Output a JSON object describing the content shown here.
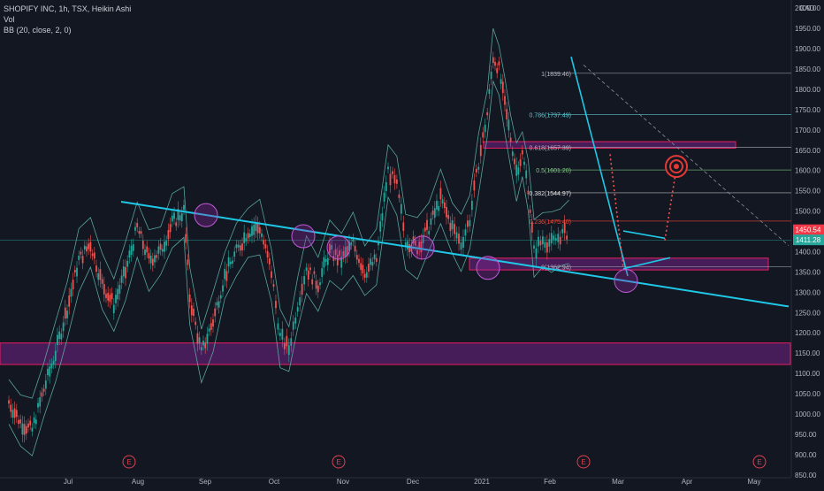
{
  "legend": {
    "title": "SHOPIFY INC, 1h, TSX, Heikin Ashi",
    "volume": "Vol",
    "bollinger": "BB (20, close, 2, 0)"
  },
  "chart_data": {
    "type": "line",
    "currency": "CAD",
    "y_ticks": [
      850,
      900,
      950,
      1000,
      1050,
      1100,
      1150,
      1200,
      1250,
      1300,
      1350,
      1400,
      1450,
      1500,
      1550,
      1600,
      1650,
      1700,
      1750,
      1800,
      1850,
      1900,
      1950,
      2000
    ],
    "y_tick_labels": [
      "850.00",
      "900.00",
      "950.00",
      "1000.00",
      "1050.00",
      "1100.00",
      "1150.00",
      "1200.00",
      "1250.00",
      "1300.00",
      "1350.00",
      "1400.00",
      "1450.00",
      "1500.00",
      "1550.00",
      "1600.00",
      "1650.00",
      "1700.00",
      "1750.00",
      "1800.00",
      "1850.00",
      "1900.00",
      "1950.00",
      "2000.00"
    ],
    "ylim": [
      843,
      2020
    ],
    "x_labels": [
      "Jul",
      "Aug",
      "Sep",
      "Oct",
      "Nov",
      "Dec",
      "2021",
      "Feb",
      "Mar",
      "Apr",
      "May"
    ],
    "price_path": [
      {
        "t": 0,
        "p": 1030
      },
      {
        "t": 4,
        "p": 980
      },
      {
        "t": 8,
        "p": 960
      },
      {
        "t": 12,
        "p": 1060
      },
      {
        "t": 16,
        "p": 1150
      },
      {
        "t": 20,
        "p": 1260
      },
      {
        "t": 24,
        "p": 1380
      },
      {
        "t": 28,
        "p": 1420
      },
      {
        "t": 32,
        "p": 1320
      },
      {
        "t": 36,
        "p": 1270
      },
      {
        "t": 40,
        "p": 1350
      },
      {
        "t": 44,
        "p": 1460
      },
      {
        "t": 48,
        "p": 1380
      },
      {
        "t": 52,
        "p": 1400
      },
      {
        "t": 56,
        "p": 1470
      },
      {
        "t": 60,
        "p": 1500
      },
      {
        "t": 62,
        "p": 1290
      },
      {
        "t": 66,
        "p": 1150
      },
      {
        "t": 70,
        "p": 1230
      },
      {
        "t": 74,
        "p": 1340
      },
      {
        "t": 78,
        "p": 1400
      },
      {
        "t": 82,
        "p": 1450
      },
      {
        "t": 86,
        "p": 1460
      },
      {
        "t": 90,
        "p": 1350
      },
      {
        "t": 93,
        "p": 1190
      },
      {
        "t": 96,
        "p": 1160
      },
      {
        "t": 99,
        "p": 1270
      },
      {
        "t": 102,
        "p": 1360
      },
      {
        "t": 106,
        "p": 1320
      },
      {
        "t": 110,
        "p": 1400
      },
      {
        "t": 114,
        "p": 1380
      },
      {
        "t": 118,
        "p": 1420
      },
      {
        "t": 122,
        "p": 1350
      },
      {
        "t": 126,
        "p": 1380
      },
      {
        "t": 130,
        "p": 1600
      },
      {
        "t": 133,
        "p": 1560
      },
      {
        "t": 136,
        "p": 1430
      },
      {
        "t": 140,
        "p": 1410
      },
      {
        "t": 144,
        "p": 1460
      },
      {
        "t": 148,
        "p": 1530
      },
      {
        "t": 152,
        "p": 1460
      },
      {
        "t": 155,
        "p": 1420
      },
      {
        "t": 158,
        "p": 1480
      },
      {
        "t": 161,
        "p": 1620
      },
      {
        "t": 164,
        "p": 1740
      },
      {
        "t": 166,
        "p": 1880
      },
      {
        "t": 168,
        "p": 1850
      },
      {
        "t": 170,
        "p": 1760
      },
      {
        "t": 172,
        "p": 1680
      },
      {
        "t": 174,
        "p": 1600
      },
      {
        "t": 176,
        "p": 1640
      },
      {
        "t": 178,
        "p": 1560
      },
      {
        "t": 180,
        "p": 1400
      },
      {
        "t": 183,
        "p": 1430
      },
      {
        "t": 186,
        "p": 1420
      },
      {
        "t": 189,
        "p": 1440
      },
      {
        "t": 192,
        "p": 1450
      }
    ],
    "projection": [
      {
        "t": 192,
        "p": 1450
      },
      {
        "t": 197,
        "p": 1580
      },
      {
        "t": 200,
        "p": 1610
      }
    ],
    "fib_levels": [
      {
        "label": "1(1839.46)",
        "value": 1839.46,
        "color": "#b2b5be"
      },
      {
        "label": "0.786(1737.49)",
        "value": 1737.49,
        "color": "#5fc9d3"
      },
      {
        "label": "0.618(1657.39)",
        "value": 1657.39,
        "color": "#b2b5be"
      },
      {
        "label": "0.5(1601.20)",
        "value": 1601.2,
        "color": "#81c784"
      },
      {
        "label": "0.382(1544.97)",
        "value": 1544.97,
        "color": "#e0e0e0"
      },
      {
        "label": "0.236(1475.40)",
        "value": 1475.4,
        "color": "#f44336"
      },
      {
        "label": "0(1362.94)",
        "value": 1362.94,
        "color": "#b2b5be"
      }
    ],
    "price_labels": [
      {
        "text": "1450.54",
        "value": 1454,
        "color": "#f23645"
      },
      {
        "text": "1411.28",
        "value": 1429,
        "color": "#26a69a"
      }
    ]
  },
  "colors": {
    "background": "#131722",
    "trendline": "#1ec8e6",
    "zone": "#9c27b0",
    "zone_border": "#e91e63",
    "bull": "#26a69a",
    "bear": "#ef5350",
    "band": "#5fb3a8"
  }
}
